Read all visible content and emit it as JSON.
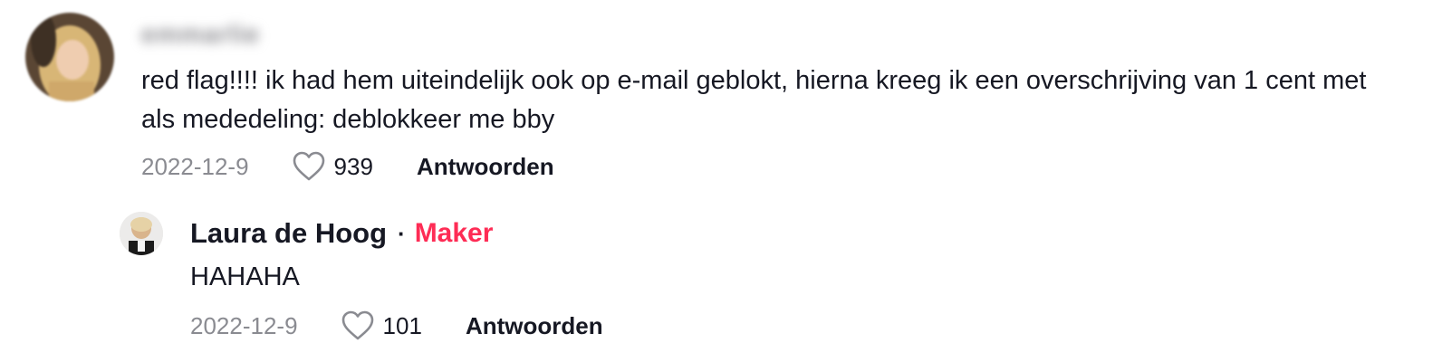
{
  "comment": {
    "username": "emmarlie",
    "text": "red flag!!!! ik had hem uiteindelijk ook op e-mail geblokt, hierna kreeg ik een overschrijving van 1 cent met als mededeling: deblokkeer me bby",
    "date": "2022-12-9",
    "likes": "939",
    "reply_label": "Antwoorden"
  },
  "reply": {
    "author": "Laura de Hoog",
    "separator": "·",
    "badge": "Maker",
    "text": "HAHAHA",
    "date": "2022-12-9",
    "likes": "101",
    "reply_label": "Antwoorden"
  },
  "colors": {
    "creator_badge": "#fe2c55",
    "date_text": "#8a8b91",
    "heart_outline": "#8a8b91"
  },
  "icons": {
    "like": "heart-outline-icon"
  }
}
